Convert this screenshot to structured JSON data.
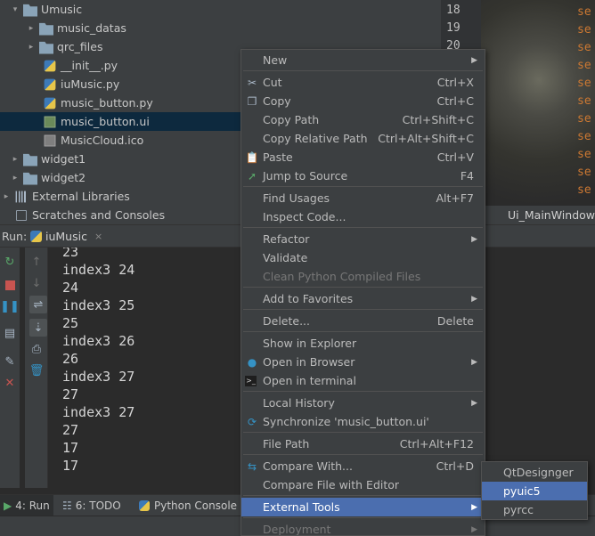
{
  "tree": [
    {
      "label": "Umusic",
      "icon": "folder-icon",
      "indent": 0,
      "arrow": "▾"
    },
    {
      "label": "music_datas",
      "icon": "folder-icon",
      "indent": 1,
      "arrow": "▸"
    },
    {
      "label": "qrc_files",
      "icon": "folder-icon",
      "indent": 1,
      "arrow": "▸"
    },
    {
      "label": "__init__.py",
      "icon": "python-file-icon",
      "indent": 1,
      "arrow": ""
    },
    {
      "label": "iuMusic.py",
      "icon": "python-file-icon",
      "indent": 1,
      "arrow": ""
    },
    {
      "label": "music_button.py",
      "icon": "python-file-icon",
      "indent": 1,
      "arrow": ""
    },
    {
      "label": "music_button.ui",
      "icon": "ui-file-icon",
      "indent": 1,
      "arrow": ""
    },
    {
      "label": "MusicCloud.ico",
      "icon": "image-file-icon",
      "indent": 1,
      "arrow": ""
    },
    {
      "label": "widget1",
      "icon": "folder-icon",
      "indent": 0,
      "arrow": "▸"
    },
    {
      "label": "widget2",
      "icon": "folder-icon",
      "indent": 0,
      "arrow": "▸"
    },
    {
      "label": "External Libraries",
      "icon": "library-icon",
      "indent": -1,
      "arrow": "▸"
    },
    {
      "label": "Scratches and Consoles",
      "icon": "scratches-icon",
      "indent": -1,
      "arrow": ""
    }
  ],
  "editor": {
    "line_numbers": [
      "18",
      "19",
      "20"
    ],
    "code_fragment": "se",
    "breadcrumb": "Ui_MainWindow"
  },
  "run": {
    "label": "Run:",
    "tab_label": "iuMusic",
    "close": "×",
    "console_lines": [
      "23",
      "index3 24",
      "24",
      "index3 25",
      "25",
      "index3 26",
      "26",
      "index3 27",
      "27",
      "index3 27",
      "27",
      "17",
      "17"
    ]
  },
  "bottom_tabs": [
    {
      "label": "4: Run"
    },
    {
      "label": "6: TODO"
    },
    {
      "label": "Python Console"
    }
  ],
  "context_menu": [
    {
      "label": "New",
      "shortcut": "",
      "arrow": true,
      "icon": "",
      "state": ""
    },
    {
      "sep": true
    },
    {
      "label": "Cut",
      "shortcut": "Ctrl+X",
      "icon": "scissors-icon",
      "state": ""
    },
    {
      "label": "Copy",
      "shortcut": "Ctrl+C",
      "icon": "copy-icon",
      "state": ""
    },
    {
      "label": "Copy Path",
      "shortcut": "Ctrl+Shift+C",
      "icon": "",
      "state": ""
    },
    {
      "label": "Copy Relative Path",
      "shortcut": "Ctrl+Alt+Shift+C",
      "icon": "",
      "state": ""
    },
    {
      "label": "Paste",
      "shortcut": "Ctrl+V",
      "icon": "paste-icon",
      "state": ""
    },
    {
      "label": "Jump to Source",
      "shortcut": "F4",
      "icon": "jump-icon",
      "state": ""
    },
    {
      "sep": true
    },
    {
      "label": "Find Usages",
      "shortcut": "Alt+F7",
      "icon": "",
      "state": ""
    },
    {
      "label": "Inspect Code...",
      "shortcut": "",
      "icon": "",
      "state": ""
    },
    {
      "sep": true
    },
    {
      "label": "Refactor",
      "shortcut": "",
      "arrow": true,
      "icon": "",
      "state": ""
    },
    {
      "label": "Validate",
      "shortcut": "",
      "icon": "",
      "state": ""
    },
    {
      "label": "Clean Python Compiled Files",
      "shortcut": "",
      "icon": "",
      "state": "disabled"
    },
    {
      "sep": true
    },
    {
      "label": "Add to Favorites",
      "shortcut": "",
      "arrow": true,
      "icon": "",
      "state": ""
    },
    {
      "sep": true
    },
    {
      "label": "Delete...",
      "shortcut": "Delete",
      "icon": "",
      "state": ""
    },
    {
      "sep": true
    },
    {
      "label": "Show in Explorer",
      "shortcut": "",
      "icon": "",
      "state": ""
    },
    {
      "label": "Open in Browser",
      "shortcut": "",
      "arrow": true,
      "icon": "globe-icon",
      "state": ""
    },
    {
      "label": "Open in terminal",
      "shortcut": "",
      "icon": "terminal-icon",
      "state": ""
    },
    {
      "sep": true
    },
    {
      "label": "Local History",
      "shortcut": "",
      "arrow": true,
      "icon": "",
      "state": ""
    },
    {
      "label": "Synchronize 'music_button.ui'",
      "shortcut": "",
      "icon": "sync-icon",
      "state": ""
    },
    {
      "sep": true
    },
    {
      "label": "File Path",
      "shortcut": "Ctrl+Alt+F12",
      "icon": "",
      "state": ""
    },
    {
      "sep": true
    },
    {
      "label": "Compare With...",
      "shortcut": "Ctrl+D",
      "icon": "compare-icon",
      "state": ""
    },
    {
      "label": "Compare File with Editor",
      "shortcut": "",
      "icon": "",
      "state": ""
    },
    {
      "sep": true
    },
    {
      "label": "External Tools",
      "shortcut": "",
      "arrow": true,
      "icon": "",
      "state": "highlighted"
    },
    {
      "sep": true
    },
    {
      "label": "Deployment",
      "shortcut": "",
      "arrow": true,
      "icon": "",
      "state": "disabled"
    }
  ],
  "submenu": [
    {
      "label": "QtDesignger",
      "state": ""
    },
    {
      "label": "pyuic5",
      "state": "highlighted"
    },
    {
      "label": "pyrcc",
      "state": ""
    }
  ],
  "colors": {
    "panel_bg": "#3c3f41",
    "editor_bg": "#2b2b2b",
    "selection": "#0d293e",
    "menu_highlight": "#4b6eaf",
    "keyword_orange": "#cc7832"
  }
}
